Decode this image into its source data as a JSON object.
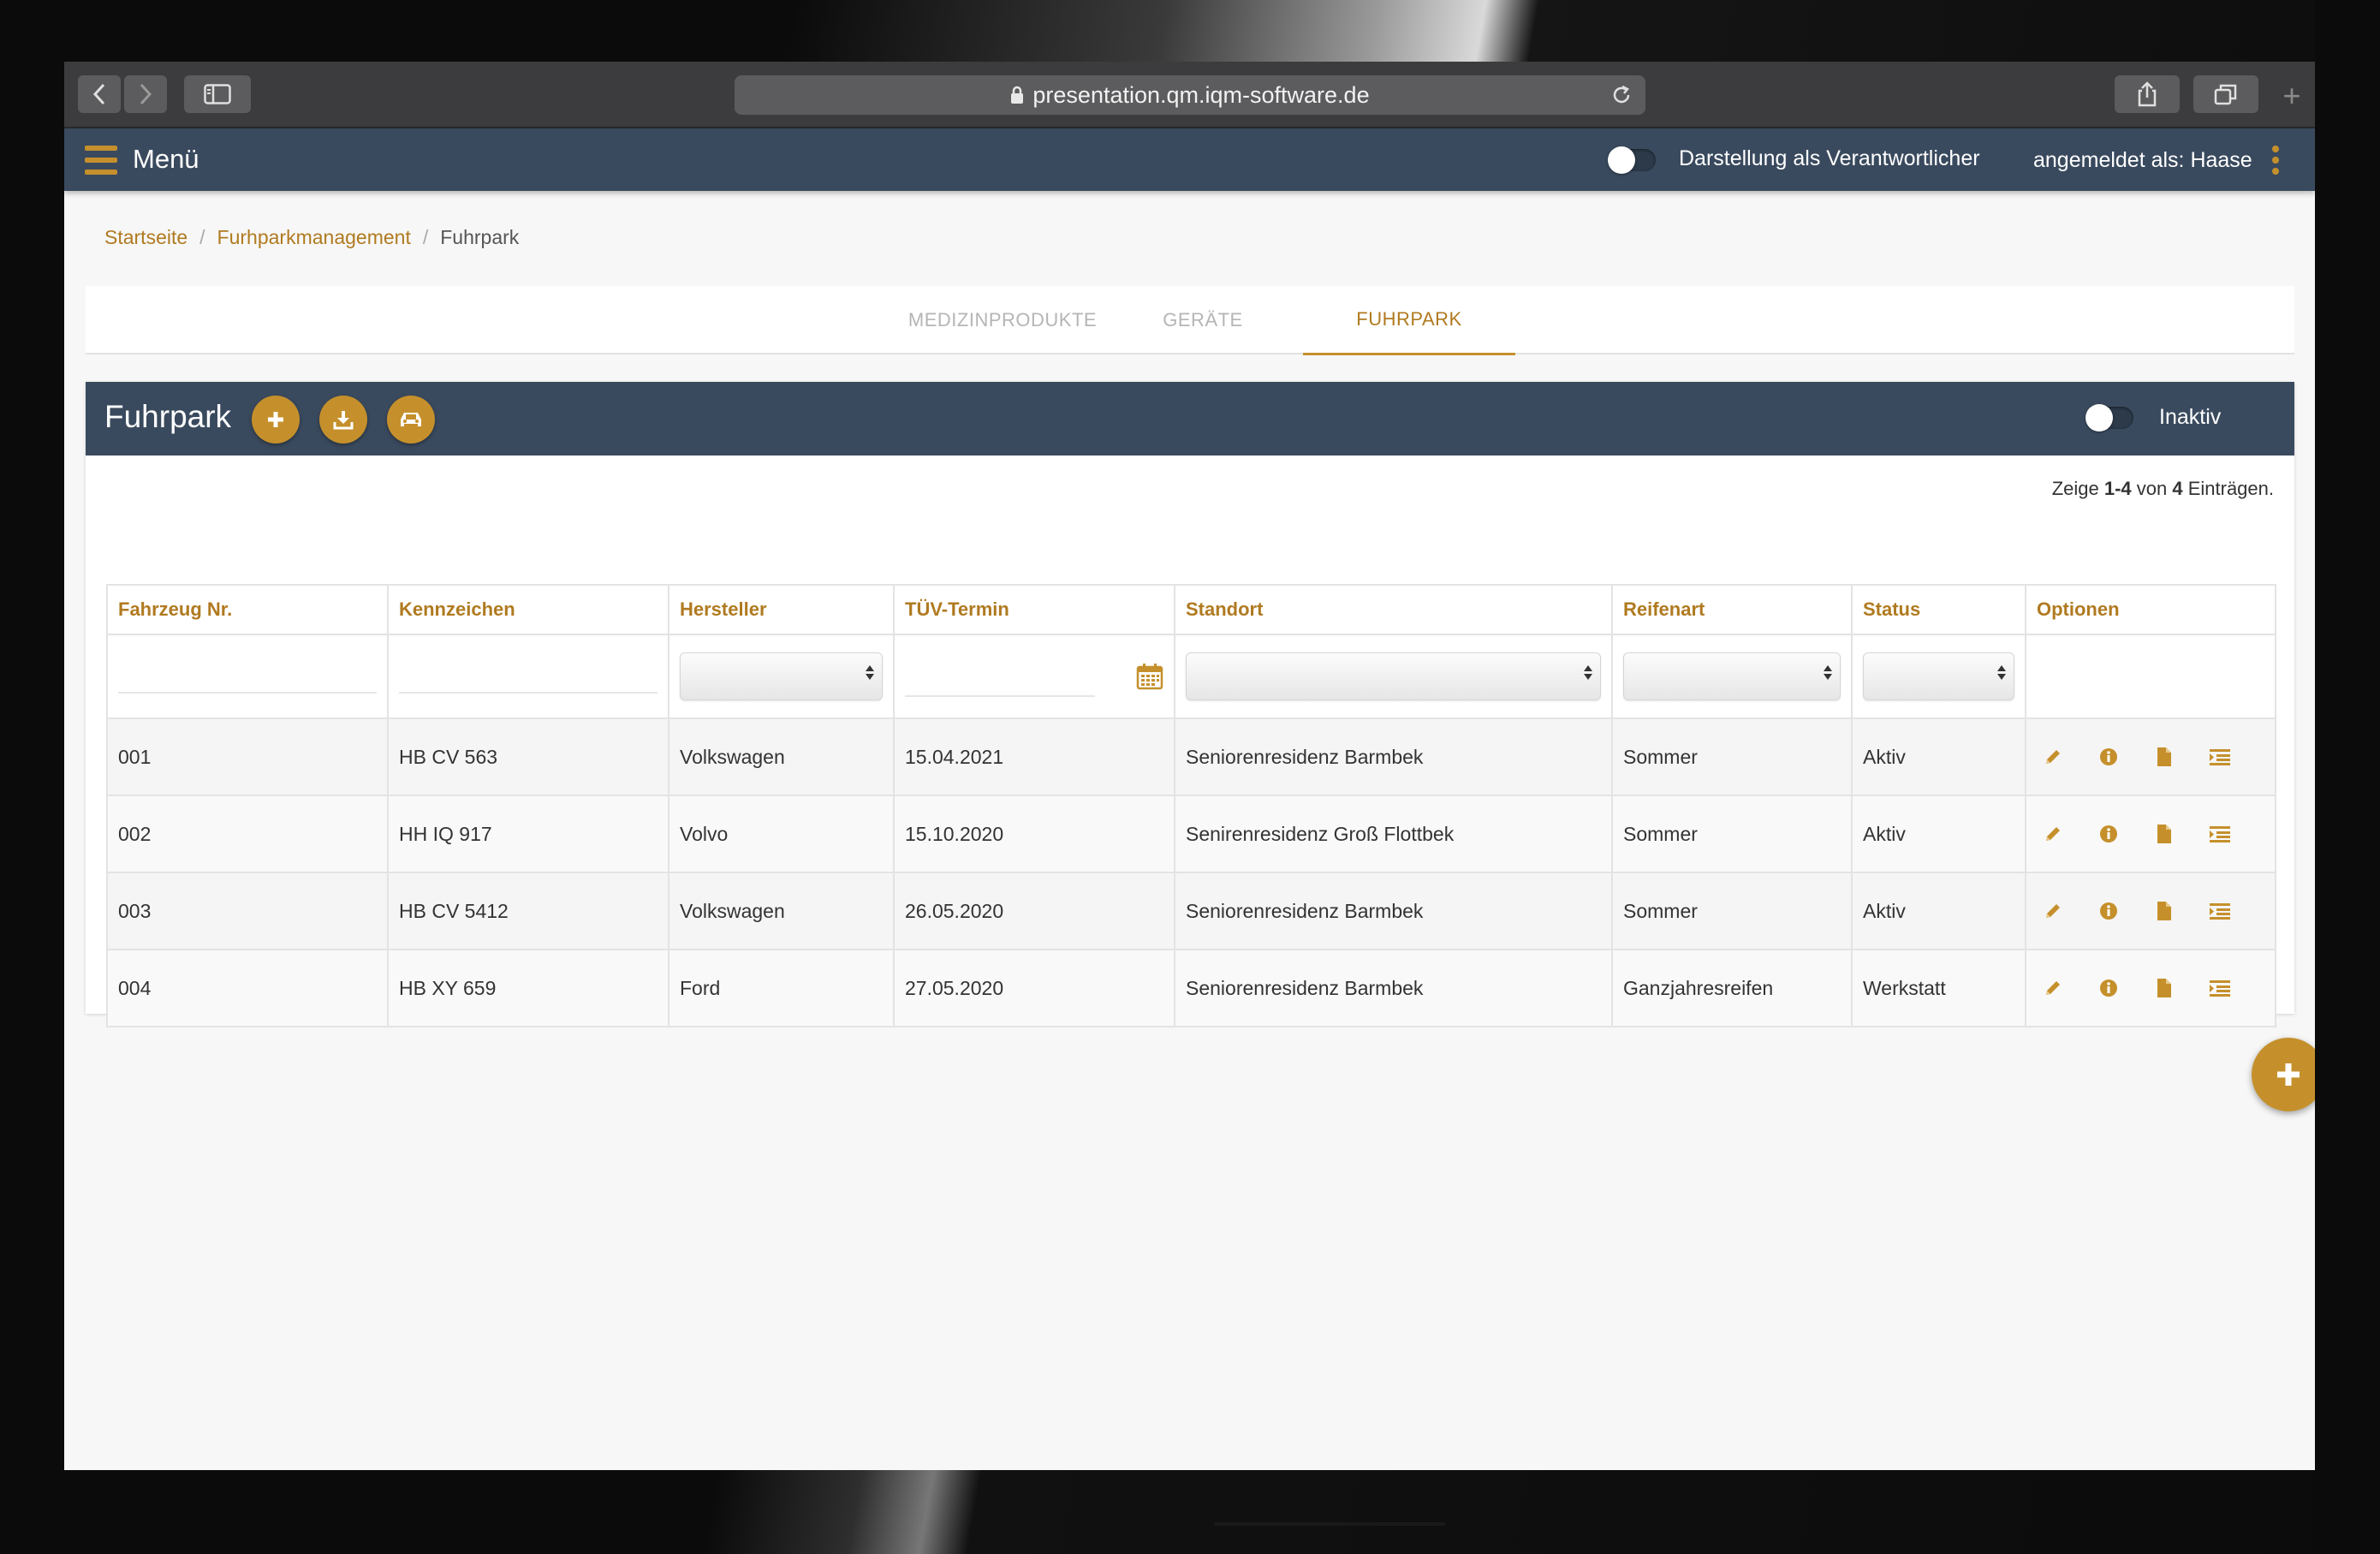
{
  "browser": {
    "url": "presentation.qm.iqm-software.de",
    "icons": [
      "chevron-left-icon",
      "chevron-right-icon",
      "sidebar-icon",
      "lock-icon",
      "reload-icon",
      "share-icon",
      "tabs-icon",
      "plus-icon"
    ]
  },
  "appbar": {
    "menu_label": "Menü",
    "responsible_label": "Darstellung als Verantwortlicher",
    "login_label": "angemeldet als: Haase"
  },
  "breadcrumb": {
    "items": [
      "Startseite",
      "Furhparkmanagement",
      "Fuhrpark"
    ]
  },
  "tabs": [
    {
      "label": "MEDIZINPRODUKTE",
      "active": false
    },
    {
      "label": "GERÄTE",
      "active": false
    },
    {
      "label": "FUHRPARK",
      "active": true
    }
  ],
  "panel": {
    "title": "Fuhrpark",
    "inactive_label": "Inaktiv",
    "count_prefix": "Zeige ",
    "count_range": "1-4",
    "count_middle": " von ",
    "count_total": "4",
    "count_suffix": " Einträgen."
  },
  "table": {
    "columns": [
      "Fahrzeug Nr.",
      "Kennzeichen",
      "Hersteller",
      "TÜV-Termin",
      "Standort",
      "Reifenart",
      "Status",
      "Optionen"
    ],
    "rows": [
      {
        "nr": "001",
        "kennzeichen": "HB CV 563",
        "hersteller": "Volkswagen",
        "tuev": "15.04.2021",
        "standort": "Seniorenresidenz Barmbek",
        "reifenart": "Sommer",
        "status": "Aktiv"
      },
      {
        "nr": "002",
        "kennzeichen": "HH IQ 917",
        "hersteller": "Volvo",
        "tuev": "15.10.2020",
        "standort": "Senirenresidenz Groß Flottbek",
        "reifenart": "Sommer",
        "status": "Aktiv"
      },
      {
        "nr": "003",
        "kennzeichen": "HB CV 5412",
        "hersteller": "Volkswagen",
        "tuev": "26.05.2020",
        "standort": "Seniorenresidenz Barmbek",
        "reifenart": "Sommer",
        "status": "Aktiv"
      },
      {
        "nr": "004",
        "kennzeichen": "HB XY 659",
        "hersteller": "Ford",
        "tuev": "27.05.2020",
        "standort": "Seniorenresidenz Barmbek",
        "reifenart": "Ganzjahresreifen",
        "status": "Werkstatt"
      }
    ]
  },
  "colors": {
    "accent": "#c5902c",
    "accent_text": "#b07a20",
    "navbar": "#3a4a5e",
    "page_bg": "#f7f7f7"
  }
}
